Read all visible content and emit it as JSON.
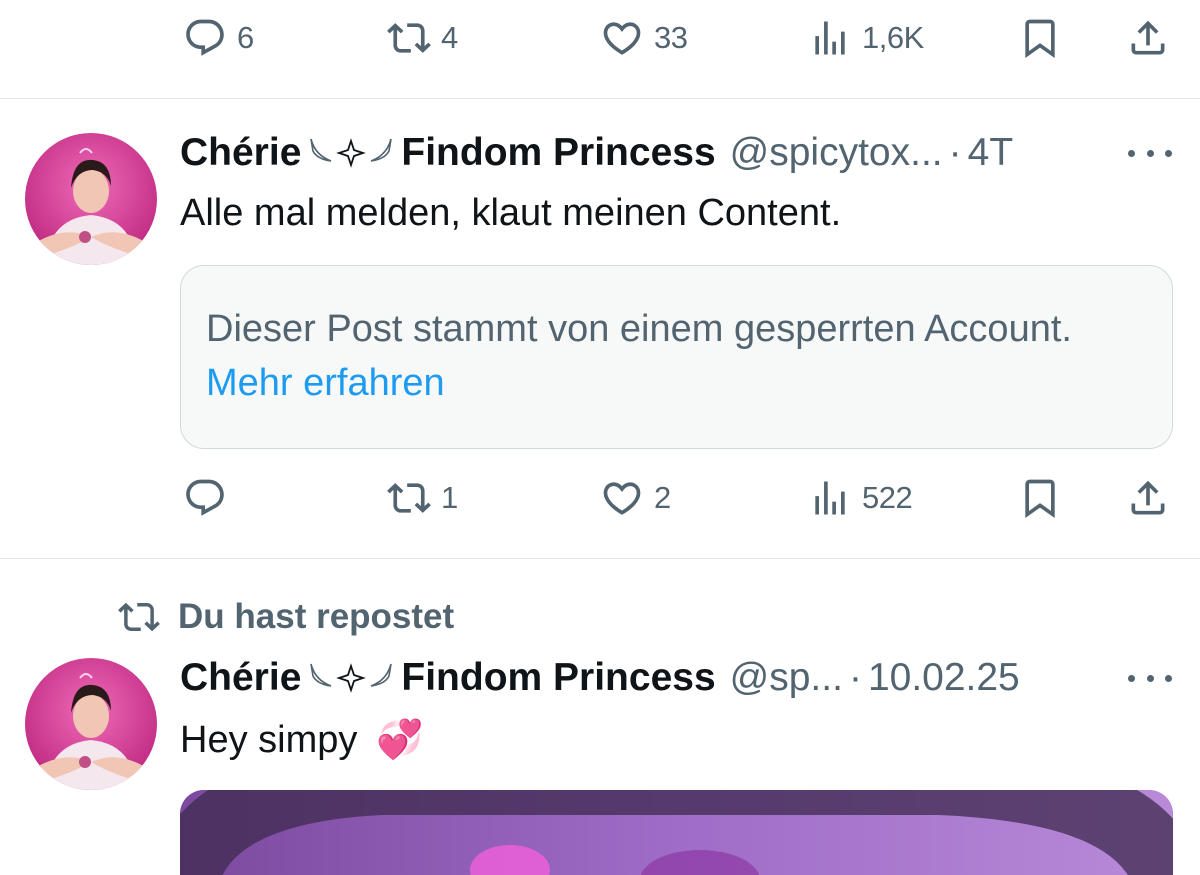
{
  "top_actions": {
    "reply_count": "6",
    "repost_count": "4",
    "like_count": "33",
    "views_count": "1,6K"
  },
  "tweet1": {
    "display_name_part1": "Chérie",
    "display_name_part2": "Findom Princess",
    "handle": "@spicytox...",
    "separator": "·",
    "time": "4T",
    "text": "Alle mal melden, klaut meinen Content.",
    "notice_text": "Dieser Post stammt von einem gesperrten Account.",
    "notice_link": "Mehr erfahren",
    "reply_count": "",
    "repost_count": "1",
    "like_count": "2",
    "views_count": "522"
  },
  "repost_label": "Du hast repostet",
  "tweet2": {
    "display_name_part1": "Chérie",
    "display_name_part2": "Findom Princess",
    "handle": "@sp...",
    "separator": "·",
    "time": "10.02.25",
    "text": "Hey simpy",
    "emoji": "💞"
  },
  "colors": {
    "text_primary": "#0f1419",
    "text_secondary": "#536471",
    "link": "#1d9bf0",
    "divider": "#e6e9ec",
    "avatar_bg": "#e0338c"
  }
}
